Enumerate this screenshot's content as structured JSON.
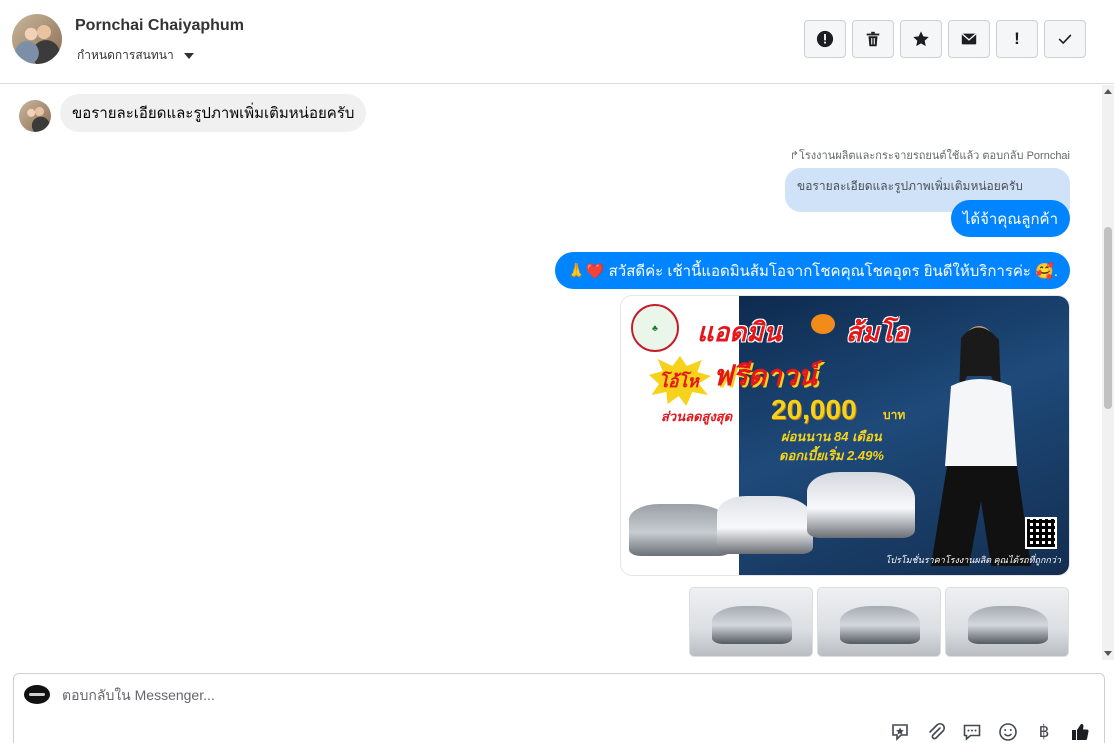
{
  "header": {
    "contact_name": "Pornchai Chaiyaphum",
    "assign_label": "กำหนดการสนทนา",
    "actions": [
      {
        "name": "report-icon",
        "label": "!"
      },
      {
        "name": "trash-icon"
      },
      {
        "name": "star-icon"
      },
      {
        "name": "mail-icon"
      },
      {
        "name": "exclamation-icon",
        "label": "!"
      },
      {
        "name": "check-icon"
      }
    ]
  },
  "messages": {
    "incoming_1": "ขอรายละเอียดและรูปภาพเพิ่มเติมหน่อยครับ",
    "reply_meta": "↱โรงงานผลิตและกระจายรถยนต์ใช้แล้ว ตอบกลับ Pornchai",
    "quoted_text": "ขอรายละเอียดและรูปภาพเพิ่มเติมหน่อยครับ",
    "outgoing_1": "ได้จ้าคุณลูกค้า",
    "outgoing_2": "🙏❤️ สวัสดีค่ะ เช้านี้แอดมินส้มโอจากโชคคุณโชคอุดร ยินดีให้บริการค่ะ 🥰."
  },
  "promo": {
    "title_part1": "แอดมิน",
    "title_part2": "ส้มโอ",
    "badge": "โอ้โห",
    "headline": "ฟรีดาวน์",
    "discount_label": "ส่วนลดสูงสุด",
    "discount_amount": "20,000",
    "currency": "บาท",
    "term": "ผ่อนนาน 84 เดือน",
    "rate": "ดอกเบี้ยเริ่ม 2.49%",
    "footer": "โปรโมชั่นราคาโรงงานผลิต คุณได้รถที่ถูกกว่า"
  },
  "composer": {
    "placeholder": "ตอบกลับใน Messenger...",
    "tools": [
      "sticker-icon",
      "attachment-icon",
      "saved-reply-icon",
      "emoji-icon",
      "baht-icon",
      "thumbs-up-icon"
    ],
    "baht_symbol": "฿"
  },
  "colors": {
    "accent": "#0084ff",
    "incoming_bubble": "#f0f0f0",
    "quote_bubble": "#cfe2f8",
    "promo_red": "#e3161b",
    "promo_yellow": "#f7d21a"
  }
}
